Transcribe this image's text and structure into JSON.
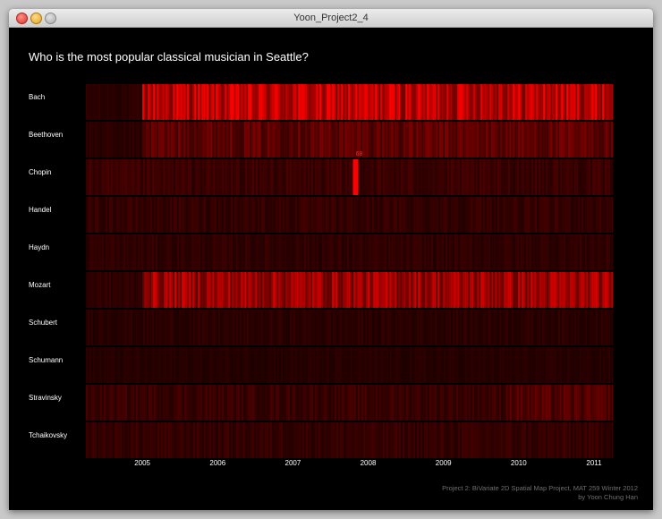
{
  "window": {
    "title": "Yoon_Project2_4"
  },
  "colors": {
    "background": "#000000",
    "low": "#1a0000",
    "high": "#ff0000",
    "highlight_label": "#e03030"
  },
  "chart_data": {
    "type": "heatmap",
    "title": "Who is the most popular classical musician in Seattle?",
    "rows": [
      "Bach",
      "Beethoven",
      "Chopin",
      "Handel",
      "Haydn",
      "Mozart",
      "Schubert",
      "Schumann",
      "Stravinsky",
      "Tchaikovsky"
    ],
    "x_ticks": [
      "2005",
      "2006",
      "2007",
      "2008",
      "2009",
      "2010",
      "2011"
    ],
    "xlim": [
      "2004-10",
      "2011-10"
    ],
    "value_range": [
      0,
      68
    ],
    "row_levels": [
      {
        "name": "Bach",
        "segments": [
          {
            "from": "2004-10",
            "to": "2005-07",
            "level": 0.1
          },
          {
            "from": "2005-07",
            "to": "2011-10",
            "level": 0.72
          }
        ]
      },
      {
        "name": "Beethoven",
        "segments": [
          {
            "from": "2004-10",
            "to": "2005-07",
            "level": 0.1
          },
          {
            "from": "2005-07",
            "to": "2011-10",
            "level": 0.32
          }
        ]
      },
      {
        "name": "Chopin",
        "segments": [
          {
            "from": "2004-10",
            "to": "2011-10",
            "level": 0.16
          }
        ]
      },
      {
        "name": "Handel",
        "segments": [
          {
            "from": "2004-10",
            "to": "2011-10",
            "level": 0.14
          }
        ]
      },
      {
        "name": "Haydn",
        "segments": [
          {
            "from": "2004-10",
            "to": "2011-10",
            "level": 0.12
          }
        ]
      },
      {
        "name": "Mozart",
        "segments": [
          {
            "from": "2004-10",
            "to": "2005-07",
            "level": 0.12
          },
          {
            "from": "2005-07",
            "to": "2011-10",
            "level": 0.58
          }
        ]
      },
      {
        "name": "Schubert",
        "segments": [
          {
            "from": "2004-10",
            "to": "2011-10",
            "level": 0.1
          }
        ]
      },
      {
        "name": "Schumann",
        "segments": [
          {
            "from": "2004-10",
            "to": "2011-10",
            "level": 0.08
          }
        ]
      },
      {
        "name": "Stravinsky",
        "segments": [
          {
            "from": "2004-10",
            "to": "2010-05",
            "level": 0.16
          },
          {
            "from": "2010-05",
            "to": "2011-10",
            "level": 0.26
          }
        ]
      },
      {
        "name": "Tchaikovsky",
        "segments": [
          {
            "from": "2004-10",
            "to": "2011-10",
            "level": 0.14
          }
        ]
      }
    ],
    "highlight": {
      "row": "Chopin",
      "date": "2008-05",
      "value": 68,
      "label": "68"
    },
    "footer": {
      "line1": "Project 2: BiVariate 2D Spatial Map Project, MAT 259 Winter 2012",
      "line2": "by Yoon Chung Han"
    }
  }
}
